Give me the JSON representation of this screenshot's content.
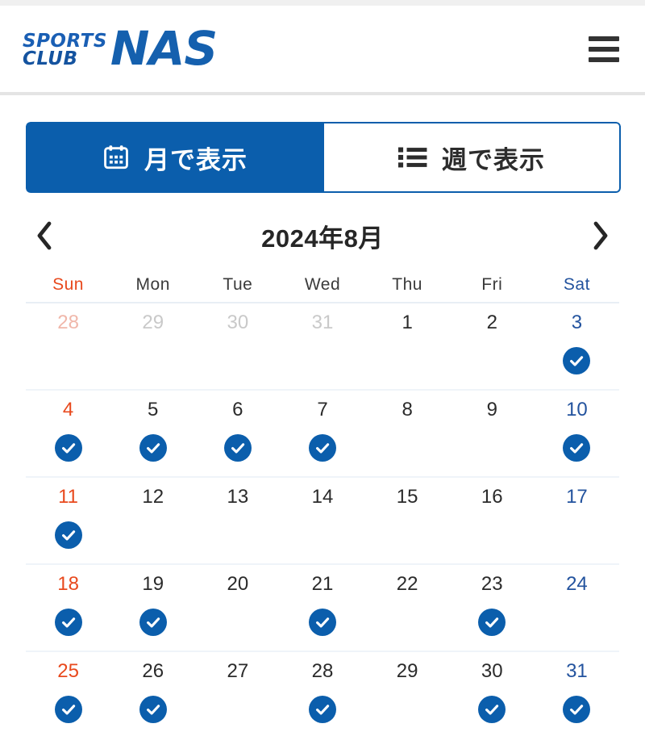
{
  "header": {
    "logo": {
      "line1": "SPORTS",
      "line2": "CLUB",
      "mark": "NAS",
      "color": "#1560ae"
    },
    "menu_label": "menu"
  },
  "view_tabs": [
    {
      "id": "month",
      "label": "月で表示",
      "icon": "calendar-icon",
      "active": true
    },
    {
      "id": "week",
      "label": "週で表示",
      "icon": "list-icon",
      "active": false
    }
  ],
  "month_nav": {
    "prev_label": "‹",
    "next_label": "›",
    "title": "2024年8月"
  },
  "calendar": {
    "accent_color": "#0b5eac",
    "sunday_color": "#e8491d",
    "saturday_color": "#23539e",
    "weekday_headers": [
      "Sun",
      "Mon",
      "Tue",
      "Wed",
      "Thu",
      "Fri",
      "Sat"
    ],
    "weeks": [
      [
        {
          "day": "28",
          "in_month": false,
          "checked": false
        },
        {
          "day": "29",
          "in_month": false,
          "checked": false
        },
        {
          "day": "30",
          "in_month": false,
          "checked": false
        },
        {
          "day": "31",
          "in_month": false,
          "checked": false
        },
        {
          "day": "1",
          "in_month": true,
          "checked": false
        },
        {
          "day": "2",
          "in_month": true,
          "checked": false
        },
        {
          "day": "3",
          "in_month": true,
          "checked": true
        }
      ],
      [
        {
          "day": "4",
          "in_month": true,
          "checked": true
        },
        {
          "day": "5",
          "in_month": true,
          "checked": true
        },
        {
          "day": "6",
          "in_month": true,
          "checked": true
        },
        {
          "day": "7",
          "in_month": true,
          "checked": true
        },
        {
          "day": "8",
          "in_month": true,
          "checked": false
        },
        {
          "day": "9",
          "in_month": true,
          "checked": false
        },
        {
          "day": "10",
          "in_month": true,
          "checked": true
        }
      ],
      [
        {
          "day": "11",
          "in_month": true,
          "checked": true
        },
        {
          "day": "12",
          "in_month": true,
          "checked": false
        },
        {
          "day": "13",
          "in_month": true,
          "checked": false
        },
        {
          "day": "14",
          "in_month": true,
          "checked": false
        },
        {
          "day": "15",
          "in_month": true,
          "checked": false
        },
        {
          "day": "16",
          "in_month": true,
          "checked": false
        },
        {
          "day": "17",
          "in_month": true,
          "checked": false
        }
      ],
      [
        {
          "day": "18",
          "in_month": true,
          "checked": true
        },
        {
          "day": "19",
          "in_month": true,
          "checked": true
        },
        {
          "day": "20",
          "in_month": true,
          "checked": false
        },
        {
          "day": "21",
          "in_month": true,
          "checked": true
        },
        {
          "day": "22",
          "in_month": true,
          "checked": false
        },
        {
          "day": "23",
          "in_month": true,
          "checked": true
        },
        {
          "day": "24",
          "in_month": true,
          "checked": false
        }
      ],
      [
        {
          "day": "25",
          "in_month": true,
          "checked": true
        },
        {
          "day": "26",
          "in_month": true,
          "checked": true
        },
        {
          "day": "27",
          "in_month": true,
          "checked": false
        },
        {
          "day": "28",
          "in_month": true,
          "checked": true
        },
        {
          "day": "29",
          "in_month": true,
          "checked": false
        },
        {
          "day": "30",
          "in_month": true,
          "checked": true
        },
        {
          "day": "31",
          "in_month": true,
          "checked": true
        }
      ]
    ]
  }
}
